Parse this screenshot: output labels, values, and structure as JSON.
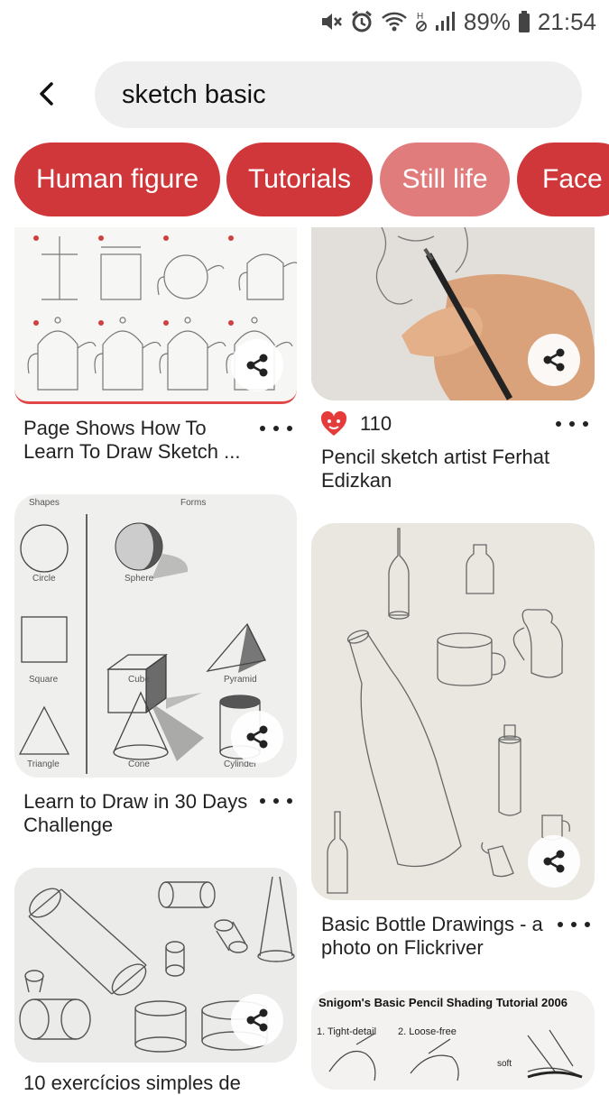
{
  "status_bar": {
    "battery": "89%",
    "time": "21:54",
    "icons": [
      "mute-icon",
      "alarm-icon",
      "wifi-icon",
      "no-sim-icon",
      "signal-icon",
      "battery-icon"
    ]
  },
  "search": {
    "query": "sketch basic"
  },
  "chips": [
    {
      "label": "Human figure"
    },
    {
      "label": "Tutorials"
    },
    {
      "label": "Still life"
    },
    {
      "label": "Face"
    }
  ],
  "pins": [
    {
      "title": "Page Shows How To Learn To Draw Sketch ..."
    },
    {
      "title": "Learn to Draw in 30 Days Challenge"
    },
    {
      "title": "10 exercícios simples de"
    },
    {
      "title": "Pencil sketch artist Ferhat Edizkan",
      "reaction_count": "110"
    },
    {
      "title": "Basic Bottle Drawings - a photo on Flickriver"
    },
    {
      "image_text": "Snigom's Basic Pencil Shading Tutorial 2006",
      "labels": [
        "1. Tight-detail",
        "2. Loose-free",
        "soft"
      ]
    }
  ],
  "shapes_chart_text": {
    "headers": [
      "Shapes",
      "Forms"
    ],
    "labels": [
      "Circle",
      "Sphere",
      "Square",
      "Cube",
      "Pyramid",
      "Triangle",
      "Cone",
      "Cylinder"
    ]
  },
  "colors": {
    "chip": "#d0373a",
    "chip_selected": "#e17c7d",
    "search_bg": "#efefef"
  }
}
